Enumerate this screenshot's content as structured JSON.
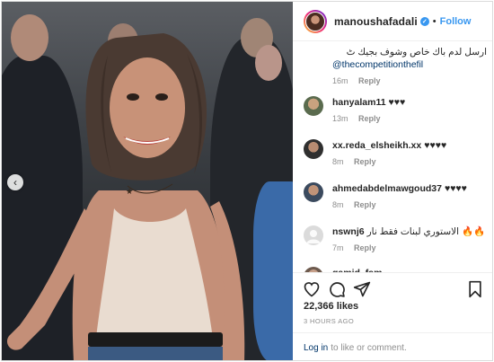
{
  "post": {
    "username": "manoushafadali",
    "verified": true,
    "separator": "•",
    "follow_label": "Follow",
    "likes": "22,366 likes",
    "time": "3 HOURS AGO"
  },
  "comments": [
    {
      "username": "",
      "text": "ارسل لدم باك خاص وشوف بجيك ٹ",
      "mention": "@thecompetitionthefil",
      "time": "16m",
      "reply_label": "Reply"
    },
    {
      "username": "hanyalam11",
      "text": "♥♥♥",
      "time": "13m",
      "reply_label": "Reply"
    },
    {
      "username": "xx.reda_elsheikh.xx",
      "text": "♥♥♥♥",
      "time": "8m",
      "reply_label": "Reply"
    },
    {
      "username": "ahmedabdelmawgoud37",
      "text": "♥♥♥♥",
      "time": "8m",
      "reply_label": "Reply"
    },
    {
      "username": "nswnj6",
      "text": "الاستوري لبنات فقط نار 🔥🔥",
      "time": "7m",
      "reply_label": "Reply"
    },
    {
      "username": "gamid_fam",
      "text": "",
      "time": "",
      "reply_label": ""
    }
  ],
  "footer": {
    "login_label": "Log in",
    "login_rest": "to like or comment."
  },
  "icons": {
    "carousel_prev": "chevron-left-icon",
    "like": "heart-icon",
    "comment": "comment-bubble-icon",
    "share": "paper-plane-icon",
    "save": "bookmark-icon"
  },
  "colors": {
    "accent": "#3897f0",
    "link": "#003569",
    "muted": "#8e8e8e",
    "text": "#262626"
  }
}
